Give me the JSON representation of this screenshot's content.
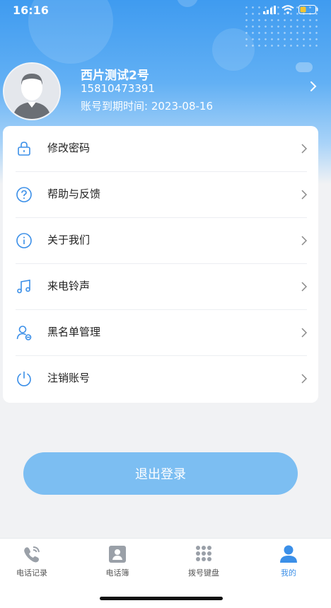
{
  "status_bar": {
    "time": "16:16"
  },
  "profile": {
    "name": "西片测试2号",
    "phone": "15810473391",
    "expire": "账号到期时间: 2023-08-16"
  },
  "menu": {
    "items": [
      {
        "label": "修改密码",
        "icon": "lock-icon"
      },
      {
        "label": "帮助与反馈",
        "icon": "question-circle-icon"
      },
      {
        "label": "关于我们",
        "icon": "info-circle-icon"
      },
      {
        "label": "来电铃声",
        "icon": "music-note-icon"
      },
      {
        "label": "黑名单管理",
        "icon": "user-block-icon"
      },
      {
        "label": "注销账号",
        "icon": "power-icon"
      }
    ]
  },
  "logout_label": "退出登录",
  "tabs": [
    {
      "label": "电话记录",
      "icon": "phone-call-icon",
      "active": false
    },
    {
      "label": "电话簿",
      "icon": "contacts-book-icon",
      "active": false
    },
    {
      "label": "拨号键盘",
      "icon": "dialpad-icon",
      "active": false
    },
    {
      "label": "我的",
      "icon": "user-profile-icon",
      "active": true
    }
  ],
  "colors": {
    "accent": "#3b8fe8",
    "header_top": "#3f9bf0",
    "logout_button": "#7cbef2",
    "menu_icon": "#3b8fe8",
    "inactive_icon": "#9aa0a8"
  }
}
